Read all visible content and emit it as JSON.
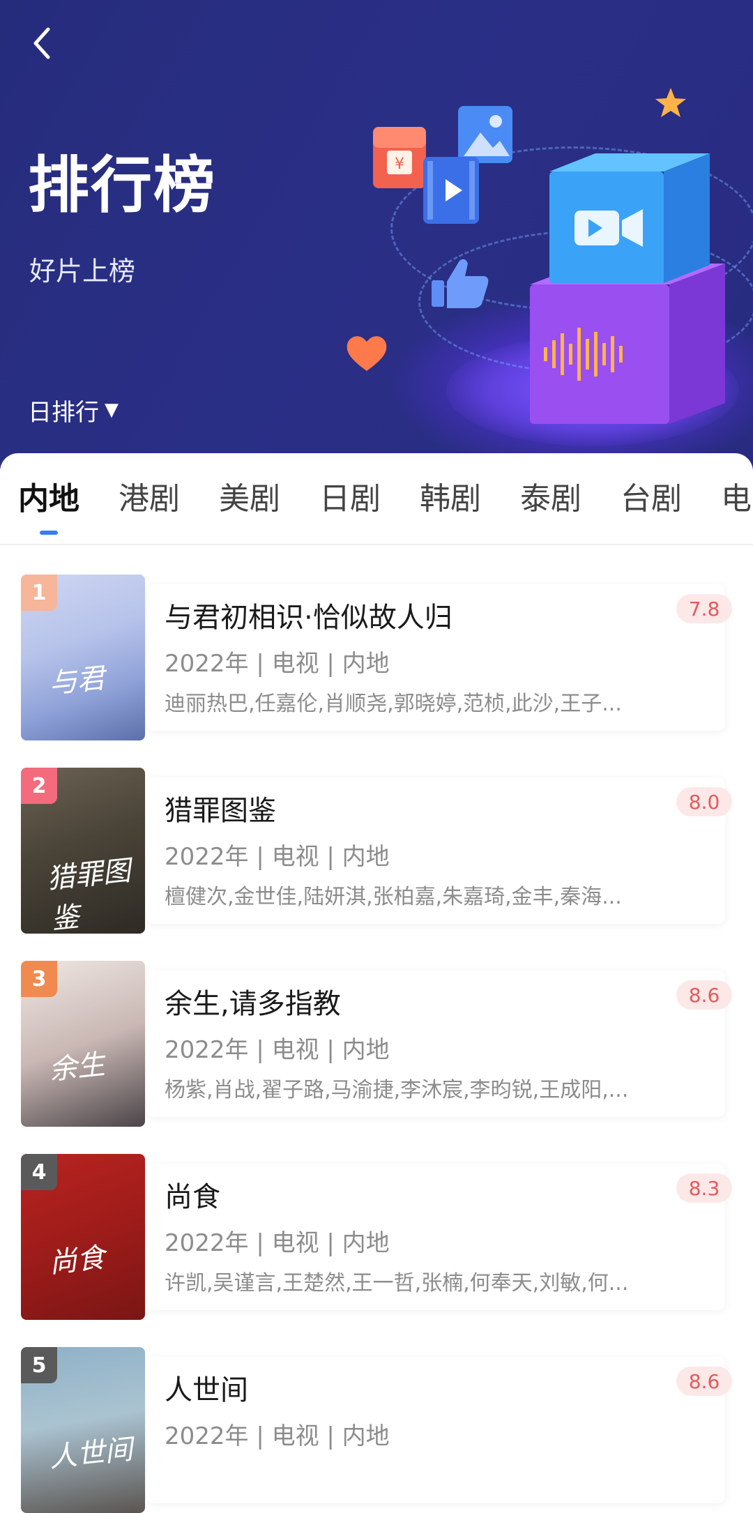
{
  "header": {
    "back_icon": "chevron-left-icon",
    "title": "排行榜",
    "subtitle": "好片上榜",
    "rank_selector": {
      "label": "日排行",
      "caret": "▼"
    }
  },
  "tabs": [
    {
      "label": "内地",
      "active": true
    },
    {
      "label": "港剧",
      "active": false
    },
    {
      "label": "美剧",
      "active": false
    },
    {
      "label": "日剧",
      "active": false
    },
    {
      "label": "韩剧",
      "active": false
    },
    {
      "label": "泰剧",
      "active": false
    },
    {
      "label": "台剧",
      "active": false
    },
    {
      "label": "电影",
      "active": false
    }
  ],
  "colors": {
    "accent": "#3d7bf0",
    "hero_bg": "#282b80",
    "score_bg": "#fde8e8",
    "score_text": "#e35a5a",
    "rank1": "#f7b59a",
    "rank2": "#f36b7c",
    "rank3": "#f08a50",
    "rank_other": "#5a5a5a"
  },
  "list": [
    {
      "rank": "1",
      "title": "与君初相识·恰似故人归",
      "meta": "2022年 | 电视 | 内地",
      "cast": "迪丽热巴,任嘉伦,肖顺尧,郭晓婷,范桢,此沙,王子...",
      "score": "7.8"
    },
    {
      "rank": "2",
      "title": "猎罪图鉴",
      "meta": "2022年 | 电视 | 内地",
      "cast": "檀健次,金世佳,陆妍淇,张柏嘉,朱嘉琦,金丰,秦海...",
      "score": "8.0"
    },
    {
      "rank": "3",
      "title": "余生,请多指教",
      "meta": "2022年 | 电视 | 内地",
      "cast": "杨紫,肖战,翟子路,马渝捷,李沐宸,李昀锐,王成阳,...",
      "score": "8.6"
    },
    {
      "rank": "4",
      "title": "尚食",
      "meta": "2022年 | 电视 | 内地",
      "cast": "许凯,吴谨言,王楚然,王一哲,张楠,何奉天,刘敏,何...",
      "score": "8.3"
    },
    {
      "rank": "5",
      "title": "人世间",
      "meta": "2022年 | 电视 | 内地",
      "cast": "",
      "score": "8.6"
    }
  ]
}
